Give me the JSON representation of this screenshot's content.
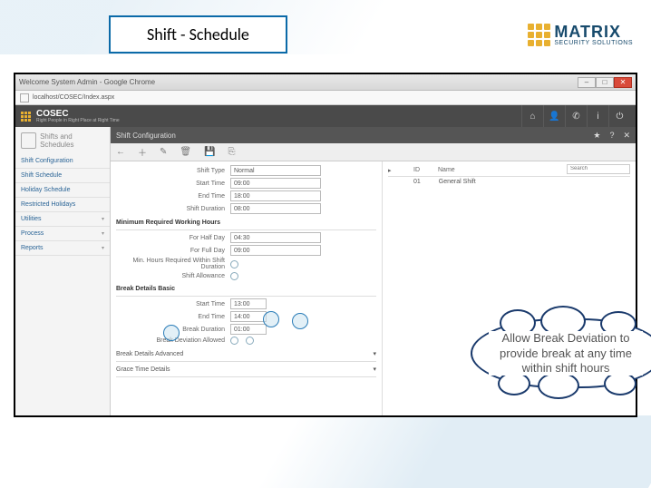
{
  "page_title": "Shift - Schedule",
  "logo": {
    "brand": "MATRIX",
    "tagline": "SECURITY SOLUTIONS"
  },
  "browser": {
    "tab_title": "Welcome System Admin - Google Chrome",
    "url": "localhost/COSEC/Index.aspx"
  },
  "app": {
    "name": "COSEC",
    "tagline": "Right People in Right Place at Right Time",
    "content_title": "Shift Configuration"
  },
  "sidebar": {
    "heading": "Shifts and Schedules",
    "items": [
      "Shift Configuration",
      "Shift Schedule",
      "Holiday Schedule",
      "Restricted Holidays",
      "Utilities",
      "Process",
      "Reports"
    ]
  },
  "form": {
    "shift_type": {
      "label": "Shift Type",
      "value": "Normal"
    },
    "start_time": {
      "label": "Start Time",
      "value": "09:00"
    },
    "end_time": {
      "label": "End Time",
      "value": "18:00"
    },
    "shift_duration": {
      "label": "Shift Duration",
      "value": "08:00"
    },
    "section_min_req": "Minimum Required Working Hours",
    "half_day": {
      "label": "For Half Day",
      "value": "04:30"
    },
    "full_day": {
      "label": "For Full Day",
      "value": "09:00"
    },
    "min_hours_shift": {
      "label": "Min. Hours Required Within Shift Duration"
    },
    "shift_allowance": {
      "label": "Shift Allowance"
    },
    "section_break": "Break Details Basic",
    "b_start": {
      "label": "Start Time",
      "value": "13:00"
    },
    "b_end": {
      "label": "End Time",
      "value": "14:00"
    },
    "b_duration": {
      "label": "Break Duration",
      "value": "01:00"
    },
    "b_dev": {
      "label": "Break Deviation Allowed"
    },
    "section_break_adv": "Break Details Advanced",
    "section_grace": "Grace Time Details"
  },
  "list": {
    "search_placeholder": "Search",
    "col_id": "ID",
    "col_name": "Name",
    "row_id": "01",
    "row_name": "General Shift"
  },
  "cloud_text": "Allow Break Deviation to provide break at any time within shift hours"
}
